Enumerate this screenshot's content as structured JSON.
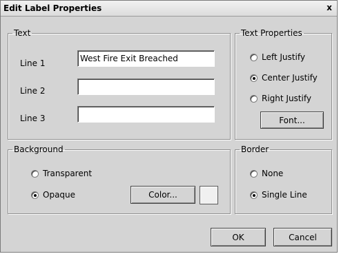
{
  "window": {
    "title": "Edit Label Properties",
    "close_glyph": "x"
  },
  "text_group": {
    "legend": "Text",
    "line1_label": "Line 1",
    "line1_value": "West Fire Exit Breached",
    "line2_label": "Line 2",
    "line2_value": "",
    "line3_label": "Line 3",
    "line3_value": ""
  },
  "text_properties": {
    "legend": "Text Properties",
    "left_label": "Left Justify",
    "center_label": "Center Justify",
    "right_label": "Right Justify",
    "selected": "center",
    "font_button": "Font..."
  },
  "background": {
    "legend": "Background",
    "transparent_label": "Transparent",
    "opaque_label": "Opaque",
    "selected": "opaque",
    "color_button": "Color...",
    "swatch_color": "#f0f0f0"
  },
  "border": {
    "legend": "Border",
    "none_label": "None",
    "single_label": "Single Line",
    "selected": "single"
  },
  "buttons": {
    "ok": "OK",
    "cancel": "Cancel"
  },
  "colors": {
    "dialog_bg": "#d4d4d4",
    "title_bg": "#e8e8e8"
  },
  "icons": {
    "close": "close-icon"
  }
}
